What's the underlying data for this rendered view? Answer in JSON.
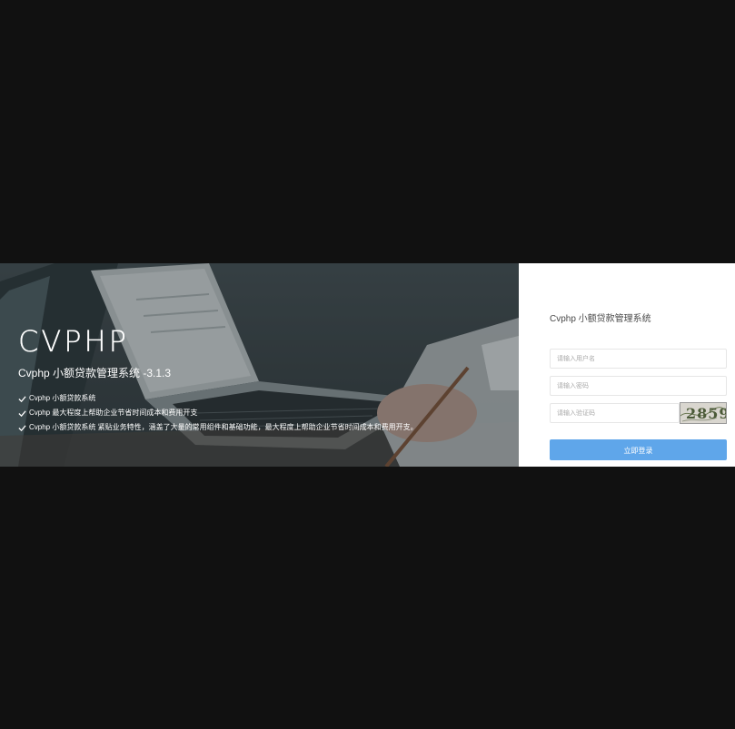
{
  "hero": {
    "brand": "CVPHP",
    "title": "Cvphp 小额贷款管理系统 -3.1.3",
    "features": [
      "Cvphp 小额贷款系统",
      "Cvphp 最大程度上帮助企业节省时间成本和费用开支",
      "Cvphp 小额贷款系统 紧贴业务特性，涵盖了大量的常用组件和基础功能，最大程度上帮助企业节省时间成本和费用开支。"
    ],
    "icon": "check-icon"
  },
  "login": {
    "title": "Cvphp 小额贷款管理系统",
    "username_placeholder": "请输入用户名",
    "password_placeholder": "请输入密码",
    "captcha_placeholder": "请输入验证码",
    "captcha_text": "2859",
    "submit_label": "立即登录"
  },
  "colors": {
    "background": "#111111",
    "button": "#5fa6ea",
    "panel": "#ffffff"
  }
}
